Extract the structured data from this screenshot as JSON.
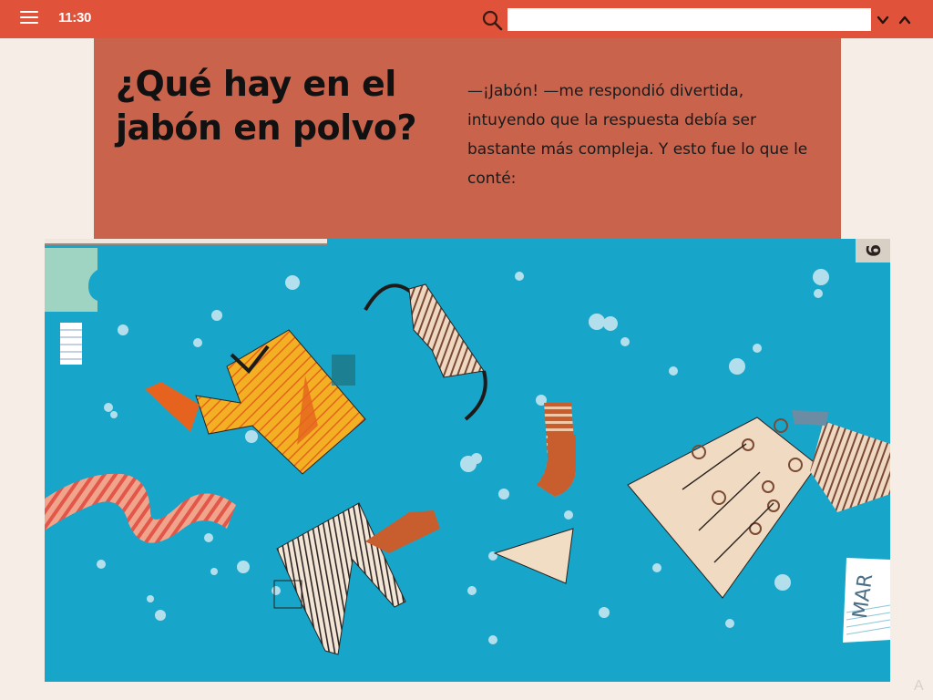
{
  "status_bar": {
    "time": "11:30"
  },
  "search": {
    "placeholder": "",
    "value": ""
  },
  "article": {
    "title": "¿Qué hay en el jabón en polvo?",
    "intro": "—¡Jabón! —me respondió divertida, intuyendo que la respuesta debía ser bastante más compleja. Y esto fue lo que le conté:"
  },
  "illustration": {
    "calendar_label": "MAR",
    "corner_number": "9",
    "background_color": "#17a6c9"
  },
  "colors": {
    "top_bar": "#e0533a",
    "header_block": "#c9634c",
    "page_bg": "#f5ede6"
  },
  "side_mark": "A"
}
